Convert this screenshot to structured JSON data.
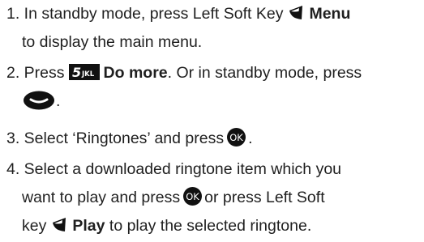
{
  "steps": [
    {
      "lines": [
        [
          "1. In standby mode, press Left Soft Key",
          "Menu"
        ],
        [
          "to display the main menu."
        ]
      ]
    },
    {
      "lines": [
        [
          "2. Press",
          "Do more",
          ". Or in standby mode, press"
        ],
        [
          "."
        ]
      ]
    },
    {
      "lines": [
        [
          "3. Select ‘Ringtones’ and press",
          "."
        ]
      ]
    },
    {
      "lines": [
        [
          "4. Select a downloaded ringtone item which you"
        ],
        [
          "want to play and press",
          "or press Left Soft"
        ],
        [
          "key",
          "Play",
          "to play the selected ringtone."
        ]
      ]
    }
  ],
  "icons": {
    "left_soft_key": "left-soft-key-icon",
    "key_5": "key-5-jkl-icon",
    "key_5_label": "5",
    "key_5_letters": "JKL",
    "send_key": "send-key-icon",
    "ok_key": "ok-key-icon",
    "ok_label": "OK"
  }
}
